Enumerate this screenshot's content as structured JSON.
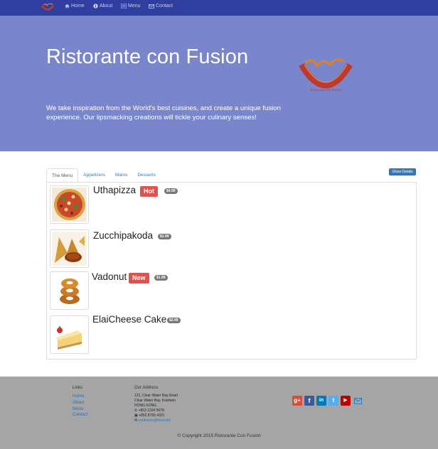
{
  "nav": {
    "items": [
      {
        "label": "Home",
        "icon": "home-icon"
      },
      {
        "label": "About",
        "icon": "info-circle-icon"
      },
      {
        "label": "Menu",
        "icon": "list-icon"
      },
      {
        "label": "Contact",
        "icon": "envelope-icon"
      }
    ]
  },
  "hero": {
    "title": "Ristorante con Fusion",
    "tagline": "We take inspiration from the World's best cuisines, and create a unique fusion experience. Our lipsmacking creations will tickle your culinary senses!"
  },
  "menu": {
    "tabs": [
      "The Menu",
      "Appetizers",
      "Mains",
      "Desserts"
    ],
    "show_details": "Show Details",
    "dishes": [
      {
        "name": "Uthapizza",
        "label": "Hot",
        "price": "$4.99",
        "image": "pizza"
      },
      {
        "name": "Zucchipakoda",
        "label": "",
        "price": "$1.99",
        "image": "pakoda"
      },
      {
        "name": "Vadonut",
        "label": "New",
        "price": "$1.99",
        "image": "donut"
      },
      {
        "name": "ElaiCheese Cake",
        "label": "",
        "price": "$2.99",
        "image": "cheesecake"
      }
    ]
  },
  "footer": {
    "links_heading": "Links",
    "links": [
      "Home",
      "About",
      "Menu",
      "Contact"
    ],
    "address_heading": "Our Address",
    "address_lines": [
      "121, Clear Water Bay Road",
      "Clear Water Bay, Kowloon",
      "HONG KONG"
    ],
    "phone": "+852 1234 5678",
    "fax": "+852 8765 4321",
    "email": "confusion@food.net",
    "social": [
      {
        "name": "google-plus",
        "glyph": "g+",
        "color": "#dd4b39"
      },
      {
        "name": "facebook",
        "glyph": "f",
        "color": "#3b5998"
      },
      {
        "name": "linkedin",
        "glyph": "in",
        "color": "#007bb6"
      },
      {
        "name": "twitter",
        "glyph": "t",
        "color": "#55acee"
      },
      {
        "name": "youtube",
        "glyph": "▶",
        "color": "#bb0000"
      }
    ],
    "copyright": "© Copyright 2015 Ristorante Con Fusion"
  },
  "colors": {
    "navbar": "#303F9F",
    "jumbotron": "#7986CB",
    "footer": "#a5a5a5",
    "label_danger": "#d9534f",
    "badge": "#777777",
    "primary": "#337ab7"
  }
}
